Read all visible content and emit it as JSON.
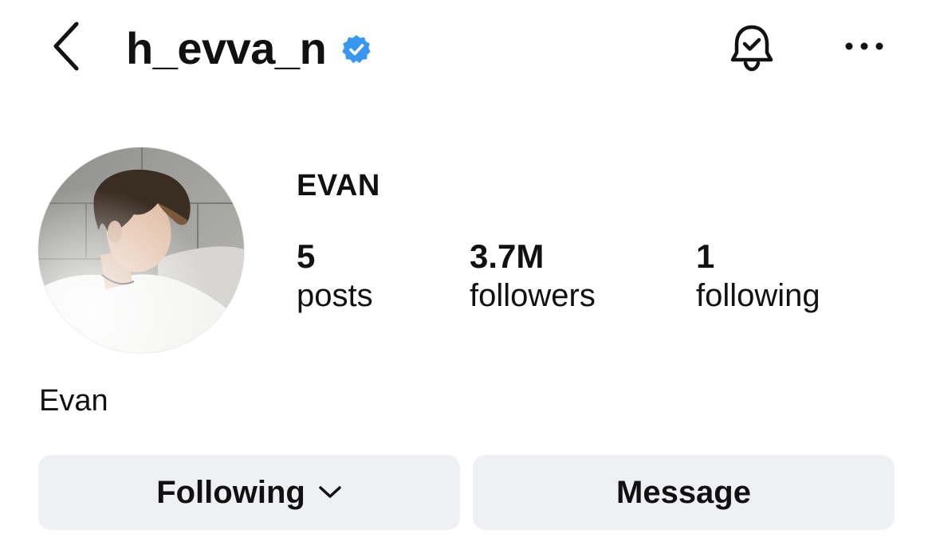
{
  "header": {
    "username": "h_evva_n",
    "back_icon": "chevron-left-icon",
    "verified_icon": "verified-badge-icon",
    "notification_icon": "bell-check-icon",
    "more_icon": "more-horizontal-icon"
  },
  "profile": {
    "display_name": "EVAN",
    "bio": "Evan",
    "stats": {
      "posts": {
        "count": "5",
        "label": "posts"
      },
      "followers": {
        "count": "3.7M",
        "label": "followers"
      },
      "following": {
        "count": "1",
        "label": "following"
      }
    }
  },
  "actions": {
    "following_label": "Following",
    "following_icon": "chevron-down-icon",
    "message_label": "Message"
  },
  "colors": {
    "verified": "#3897f0",
    "button_bg": "#eef0f3",
    "text": "#111111"
  }
}
